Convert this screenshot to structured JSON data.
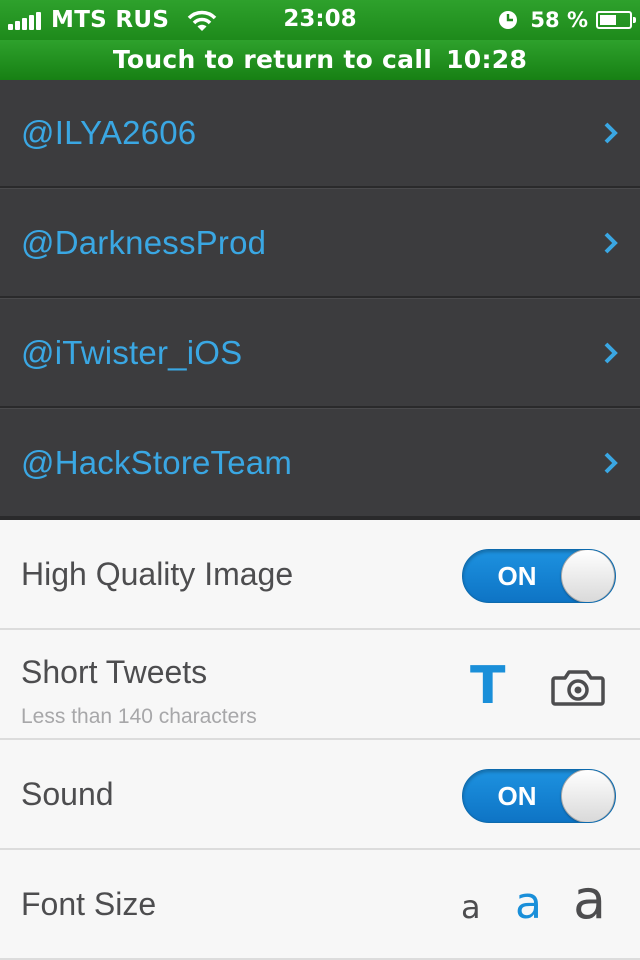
{
  "status_bar": {
    "carrier": "MTS RUS",
    "time": "23:08",
    "battery_percent": "58 %",
    "battery_level": 0.58,
    "icons": [
      "signal-icon",
      "wifi-icon",
      "clock-icon",
      "battery-icon"
    ]
  },
  "call_banner": {
    "text": "Touch to return to call",
    "timer": "10:28",
    "color": "#2ea12c"
  },
  "accounts": [
    {
      "handle": "@ILYA2606"
    },
    {
      "handle": "@DarknessProd"
    },
    {
      "handle": "@iTwister_iOS"
    },
    {
      "handle": "@HackStoreTeam"
    }
  ],
  "settings": {
    "high_quality": {
      "label": "High Quality Image",
      "toggle": "ON"
    },
    "short_tweets": {
      "label": "Short Tweets",
      "sublabel": "Less than 140 characters",
      "text_option": "T"
    },
    "sound": {
      "label": "Sound",
      "toggle": "ON"
    },
    "font_size": {
      "label": "Font Size",
      "options": [
        "a",
        "a",
        "a"
      ],
      "selected_index": 1
    }
  },
  "colors": {
    "accent": "#1a8fd9",
    "link": "#3aa7e3",
    "dark_bg": "#3c3c3e",
    "light_bg": "#f7f7f7"
  }
}
